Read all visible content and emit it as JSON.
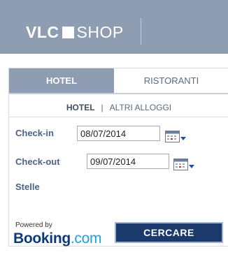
{
  "header": {
    "logo_bold": "VLC",
    "logo_light": "SHOP"
  },
  "tabs": [
    {
      "label": "HOTEL",
      "active": true
    },
    {
      "label": "RISTORANTI",
      "active": false
    }
  ],
  "subtabs": {
    "active": "HOTEL",
    "separator": "|",
    "other": "ALTRI ALLOGGI"
  },
  "form": {
    "checkin_label": "Check-in",
    "checkin_value": "08/07/2014",
    "checkout_label": "Check-out",
    "checkout_value": "09/07/2014",
    "stars_label": "Stelle"
  },
  "footer": {
    "powered_by": "Powered by",
    "booking_name": "Booking",
    "booking_domain": ".com",
    "search_button": "CERCARE"
  },
  "colors": {
    "header_bg": "#8e9db2",
    "label": "#4c6286",
    "button_bg": "#1b3a6b",
    "booking_blue": "#0b3b7a",
    "booking_light": "#1aa0e0"
  },
  "icons": [
    "calendar-icon",
    "dropdown-arrow-icon"
  ]
}
